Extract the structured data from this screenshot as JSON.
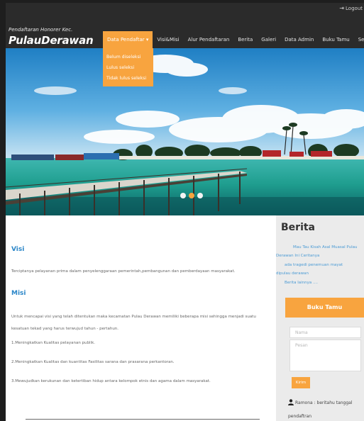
{
  "header": {
    "logout_label": "Logout",
    "brand_subtitle": "Pendaftaran Honorer Kec.",
    "brand_title": "PulauDerawan"
  },
  "nav": {
    "items": [
      {
        "label": "Data Pendaftar ▾",
        "active": true
      },
      {
        "label": "Visi&Misi"
      },
      {
        "label": "Alur Pendaftaran"
      },
      {
        "label": "Berita"
      },
      {
        "label": "Galeri"
      },
      {
        "label": "Data Admin"
      },
      {
        "label": "Buku Tamu"
      },
      {
        "label": "Setting"
      }
    ],
    "dropdown": [
      "Belum diseleksi",
      "Lulus seleksi",
      "Tidak lulus seleksi"
    ]
  },
  "hero": {
    "slide_count": 3,
    "active_slide": 1
  },
  "main": {
    "visi_heading": "Visi",
    "visi_text": "Terciptanya pelayanan prima dalam penyelenggaraan pemerintah,pembangunan dan pemberdayaan masyarakat.",
    "misi_heading": "Misi",
    "misi_intro": "Untuk mencapai visi yang telah ditentukan maka kecamatan Pulau Derawan memiliki beberapa misi sehingga menjadi suatu kesatuan tekad yang harus terwujud tahun - pertahun.",
    "misi_items": [
      "1.Meningkatkan Kualitas pelayanan publik.",
      "2.Meningkatkan Kualitas dan kuantitas Fasilitas sarana dan prasarana perkantoran.",
      "3.Mewujudkan kerukunan dan ketertiban hidup antara kelompok etnis dan agama dalam masyarakat."
    ]
  },
  "sidebar": {
    "berita_heading": "Berita",
    "news_lines": [
      "Mau Tau Kisah Asal Muasal Pulau",
      "Derawan Ini Ceritanya",
      "ada tragedi penemuan mayat",
      "dipulau derawan",
      "Berita lainnya ...."
    ],
    "guestbook_heading": "Buku Tamu",
    "name_placeholder": "Nama",
    "message_placeholder": "Pesan",
    "submit_label": "Kirim",
    "comment_line1": "Ramona : beritahu tanggal",
    "comment_line2": "pendaftran"
  },
  "colors": {
    "accent": "#f8a43f",
    "header_bg": "#2b2b2b",
    "heading_blue": "#2a86c8",
    "link_blue": "#4a9ad4",
    "sidebar_bg": "#ebebeb"
  }
}
